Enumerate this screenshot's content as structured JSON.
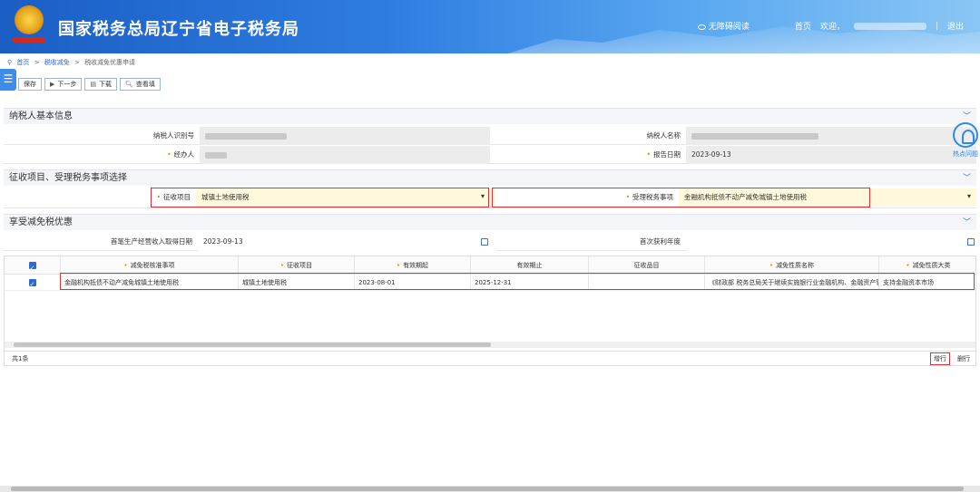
{
  "header": {
    "site_title": "国家税务总局辽宁省电子税务局",
    "accessible_reading": "无障碍阅读",
    "home": "首页",
    "welcome": "欢迎，",
    "logout": "退出"
  },
  "breadcrumb": {
    "home": "首页",
    "sep": ">",
    "level1": "税收减免",
    "level2": "税收减免优惠申请"
  },
  "toolbar": {
    "save": "保存",
    "next": "下一步",
    "download": "下载",
    "query": "查看填"
  },
  "section1": {
    "title": "纳税人基本信息",
    "taxpayer_id_label": "纳税人识别号",
    "taxpayer_name_label": "纳税人名称",
    "handler_label": "经办人",
    "report_date_label": "报告日期",
    "report_date": "2023-09-13"
  },
  "section2": {
    "title": "征收项目、受理税务事项选择",
    "levy_item_label": "征收项目",
    "levy_item_value": "城镇土地使用税",
    "matter_label": "受理税务事项",
    "matter_value": "金融机构抵债不动产减免城镇土地使用税"
  },
  "section3": {
    "title": "享受减免税优惠",
    "first_income_date_label": "首笔生产经营收入取得日期",
    "first_income_date": "2023-09-13",
    "first_profit_year_label": "首次获利年度"
  },
  "grid": {
    "columns": [
      "减免税核准事项",
      "征收项目",
      "有效期起",
      "有效期止",
      "征收品目",
      "减免性质名称",
      "减免性质大类"
    ],
    "rows": [
      [
        "金融机构抵债不动产减免城镇土地使用税",
        "城镇土地使用税",
        "2023-08-01",
        "2025-12-31",
        "",
        "《财政部 税务总局关于继续实施银行业金融机构、金融资产管...",
        "支持金融资本市场"
      ]
    ],
    "total": "共1条",
    "add_row": "增行",
    "delete_row": "删行"
  },
  "float_button": {
    "label": "热点问题"
  },
  "colors": {
    "accent": "#2d6ad6",
    "highlight": "#d9343a",
    "required": "#e58a00"
  }
}
